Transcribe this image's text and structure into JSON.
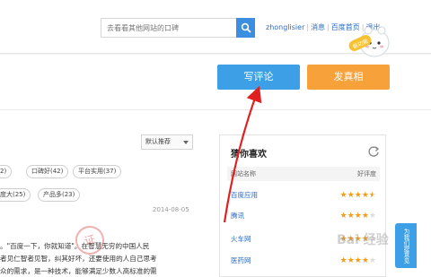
{
  "header": {
    "search_placeholder": "去看看其他网站的口碑",
    "user": "zhonglisier",
    "links": [
      "消息",
      "百度首页",
      "退出"
    ],
    "mascot_label": "新功能"
  },
  "actions": {
    "review_label": "写评论",
    "true_label": "发真相"
  },
  "sort": {
    "selected": "默认推荐"
  },
  "tags": [
    "2)",
    "口碑好(42)",
    "平台实用(37)",
    "度大(25)",
    "产品多(23)"
  ],
  "review": {
    "date": "2014-08-05",
    "stamp": "证",
    "lines": [
      "。\"百度一下，你就知道\"。在智慧无穷的中国人民",
      "者见仁智者见智，纠其好坏，还要使用的人自己思考",
      "众的需求，是一种技术，能够满足少数人高标准的需"
    ]
  },
  "guess": {
    "title": "猜你喜欢",
    "col_site": "网站名称",
    "col_score": "好评度",
    "sites": [
      {
        "name": "百度应用",
        "rating": 4.5
      },
      {
        "name": "腾讯",
        "rating": 4
      },
      {
        "name": "火车网",
        "rating": 4
      },
      {
        "name": "医药网",
        "rating": 4
      }
    ]
  },
  "side_tab": "为我们提意见",
  "watermark": "Bai 经验",
  "colors": {
    "brand_blue": "#3da0e6",
    "brand_orange": "#f7a13a",
    "link_blue": "#2b6cc4",
    "star": "#f59b16",
    "arrow_red": "#e02020"
  }
}
